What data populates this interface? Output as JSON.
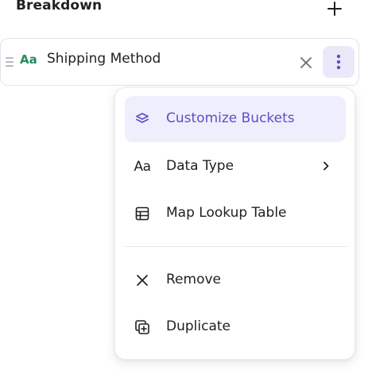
{
  "breakdown": {
    "title": "Breakdown",
    "add_icon": "plus-icon"
  },
  "row": {
    "type_glyph": "Aa",
    "label": "Shipping Method",
    "type_color": "#1e8e5a",
    "clear_icon": "close-icon",
    "more_icon": "more-vertical-icon"
  },
  "menu": {
    "accent": "#5b4fc9",
    "items": [
      {
        "label": "Customize Buckets",
        "icon": "layers-icon",
        "active": true
      },
      {
        "label": "Data Type",
        "icon": "text-type-icon",
        "glyph": "Aa",
        "submenu": true
      },
      {
        "label": "Map Lookup Table",
        "icon": "table-icon"
      },
      {
        "label": "Remove",
        "icon": "close-icon"
      },
      {
        "label": "Duplicate",
        "icon": "duplicate-icon"
      }
    ]
  }
}
